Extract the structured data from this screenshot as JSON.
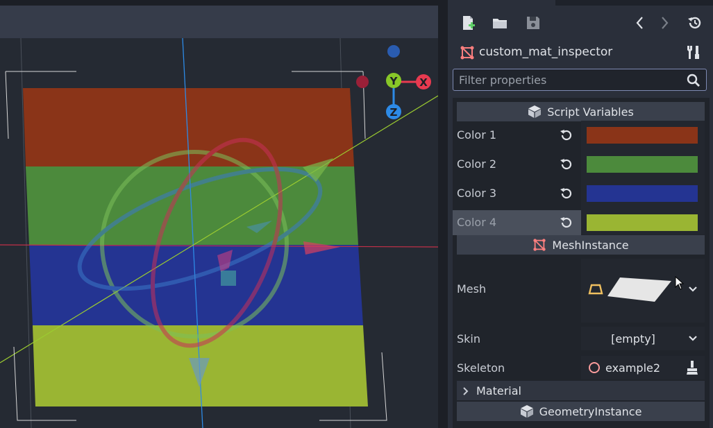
{
  "inspector": {
    "object_name": "custom_mat_inspector",
    "filter": {
      "placeholder": "Filter properties",
      "value": ""
    },
    "toolbar_icons": [
      "new-resource-icon",
      "open-folder-icon",
      "save-icon",
      "back-arrow-icon",
      "forward-arrow-icon",
      "history-icon",
      "tools-icon"
    ]
  },
  "sections": {
    "script_variables": "Script Variables",
    "mesh_instance": "MeshInstance",
    "material": "Material",
    "geometry_instance": "GeometryInstance"
  },
  "properties": {
    "color1": {
      "label": "Color 1",
      "color": "#8a3418"
    },
    "color2": {
      "label": "Color 2",
      "color": "#4c8a3c"
    },
    "color3": {
      "label": "Color 3",
      "color": "#243492"
    },
    "color4": {
      "label": "Color 4",
      "color": "#9ab533"
    },
    "mesh": {
      "label": "Mesh"
    },
    "skin": {
      "label": "Skin",
      "value": "[empty]"
    },
    "skeleton": {
      "label": "Skeleton",
      "value": "example2"
    }
  },
  "gizmo": {
    "x": "X",
    "y": "Y",
    "z": "Z"
  },
  "colors": {
    "accent": "#7e8ab3",
    "panel": "#2a2f3a",
    "axis_x": "#e83a50",
    "axis_y": "#88c728",
    "axis_z": "#2d8ae6"
  }
}
